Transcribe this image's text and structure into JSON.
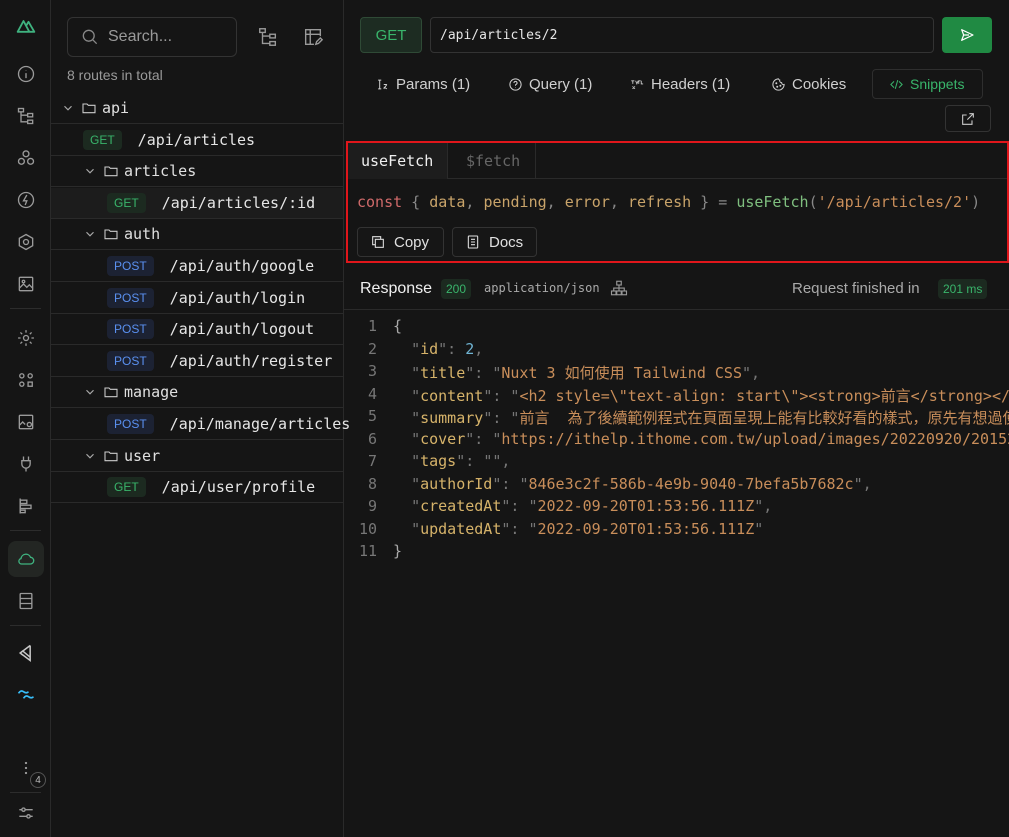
{
  "sidebar_rail": {
    "icons": [
      "nuxt-logo-icon",
      "info-icon",
      "tree-icon",
      "components-icon",
      "lightning-icon",
      "module-box-icon",
      "image-icon",
      "settings-icon",
      "layers-icon",
      "image-settings-icon",
      "plug-icon",
      "timeline-icon",
      "cloud-icon",
      "storage-icon",
      "vscode-icon",
      "tailwind-icon",
      "more-icon",
      "sliders-icon"
    ],
    "badge_count": "4"
  },
  "routes_panel": {
    "search_placeholder": "Search...",
    "routes_count": "8 routes in total",
    "tree": [
      {
        "type": "dir",
        "label": "api",
        "level": 0
      },
      {
        "type": "route",
        "method": "GET",
        "path": "/api/articles",
        "level": 0
      },
      {
        "type": "dir",
        "label": "articles",
        "level": 1
      },
      {
        "type": "route",
        "method": "GET",
        "path": "/api/articles/:id",
        "level": 1,
        "selected": true
      },
      {
        "type": "dir",
        "label": "auth",
        "level": 1
      },
      {
        "type": "route",
        "method": "POST",
        "path": "/api/auth/google",
        "level": 1
      },
      {
        "type": "route",
        "method": "POST",
        "path": "/api/auth/login",
        "level": 1
      },
      {
        "type": "route",
        "method": "POST",
        "path": "/api/auth/logout",
        "level": 1
      },
      {
        "type": "route",
        "method": "POST",
        "path": "/api/auth/register",
        "level": 1
      },
      {
        "type": "dir",
        "label": "manage",
        "level": 1
      },
      {
        "type": "route",
        "method": "POST",
        "path": "/api/manage/articles",
        "level": 1
      },
      {
        "type": "dir",
        "label": "user",
        "level": 1
      },
      {
        "type": "route",
        "method": "GET",
        "path": "/api/user/profile",
        "level": 1
      }
    ]
  },
  "request": {
    "method": "GET",
    "url": "/api/articles/2"
  },
  "tabs": {
    "params": "Params (1)",
    "query": "Query (1)",
    "headers": "Headers (1)",
    "cookies": "Cookies",
    "snippets": "Snippets"
  },
  "snippet": {
    "tab_active": "useFetch",
    "tab_inactive": "$fetch",
    "code": {
      "kw": "const",
      "open": " { ",
      "v1": "data",
      "v2": "pending",
      "v3": "error",
      "v4": "refresh",
      "close": " } = ",
      "fn": "useFetch",
      "paren_open": "(",
      "arg": "'/api/articles/2'",
      "paren_close": ")"
    },
    "copy_label": "Copy",
    "docs_label": "Docs"
  },
  "response": {
    "label": "Response",
    "status": "200",
    "content_type": "application/json",
    "finished_label": "Request finished in",
    "duration": "201 ms",
    "lines": [
      {
        "n": "1",
        "kind": "brace",
        "text": "{"
      },
      {
        "n": "2",
        "kind": "num",
        "key": "id",
        "value": "2"
      },
      {
        "n": "3",
        "kind": "str",
        "key": "title",
        "value": "Nuxt 3 如何使用 Tailwind CSS"
      },
      {
        "n": "4",
        "kind": "str",
        "key": "content",
        "value": "<h2 style=\\\"text-align: start\\\"><strong>前言</strong></"
      },
      {
        "n": "5",
        "kind": "str",
        "key": "summary",
        "value": "前言  為了後續範例程式在頁面呈現上能有比較好看的樣式，原先有想過使"
      },
      {
        "n": "6",
        "kind": "str",
        "key": "cover",
        "value": "https://ithelp.ithome.com.tw/upload/images/20220920/20152"
      },
      {
        "n": "7",
        "kind": "str",
        "key": "tags",
        "value": ""
      },
      {
        "n": "8",
        "kind": "str",
        "key": "authorId",
        "value": "846e3c2f-586b-4e9b-9040-7befa5b7682c"
      },
      {
        "n": "9",
        "kind": "str",
        "key": "createdAt",
        "value": "2022-09-20T01:53:56.111Z"
      },
      {
        "n": "10",
        "kind": "str",
        "key": "updatedAt",
        "value": "2022-09-20T01:53:56.111Z",
        "last": true
      },
      {
        "n": "11",
        "kind": "brace",
        "text": "}"
      }
    ]
  }
}
